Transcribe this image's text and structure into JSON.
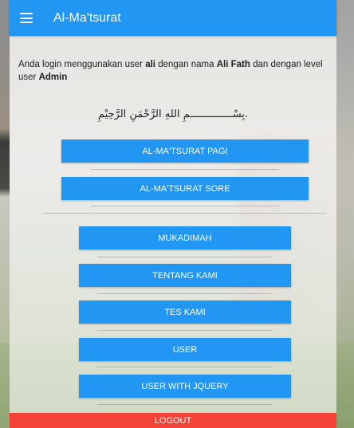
{
  "header": {
    "title": "Al-Ma'tsurat"
  },
  "info": {
    "prefix": "Anda login menggunakan user ",
    "user": "ali",
    "middle1": " dengan nama ",
    "name": "Ali Fath",
    "middle2": " dan dengan level user ",
    "level": "Admin"
  },
  "basmalah": ".بِسْــــــــــــــمِ اللهِ الرَّحْمَنِ الرَّحِيْمِ",
  "buttons": {
    "pagi": "AL-MA'TSURAT PAGI",
    "sore": "AL-MA'TSURAT SORE",
    "mukadimah": "MUKADIMAH",
    "tentang": "TENTANG KAMI",
    "tes": "TES KAMI",
    "user": "USER",
    "user_jquery": "USER WITH JQUERY",
    "logout": "LOGOUT"
  },
  "colors": {
    "primary": "#2196f3",
    "danger": "#f44336"
  }
}
